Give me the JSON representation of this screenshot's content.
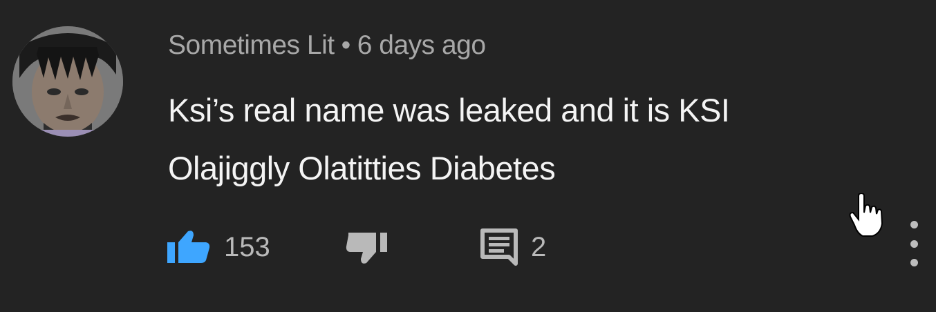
{
  "comment": {
    "author": "Sometimes Lit",
    "separator": "•",
    "timestamp": "6 days ago",
    "text_lines": [
      "Ksi’s real name was leaked and it is KSI",
      "Olajiggly Olatitties Diabetes"
    ],
    "likes": "153",
    "replies": "2"
  },
  "colors": {
    "background": "#232323",
    "meta_text": "#a8a8a8",
    "body_text": "#f4f4f4",
    "like_active": "#3ea6ff",
    "icon_gray": "#b9b9b9"
  },
  "icons": {
    "like": "thumbs-up-icon",
    "dislike": "thumbs-down-icon",
    "reply": "comment-icon",
    "more": "more-vert-icon",
    "cursor": "hand-pointer-icon"
  }
}
